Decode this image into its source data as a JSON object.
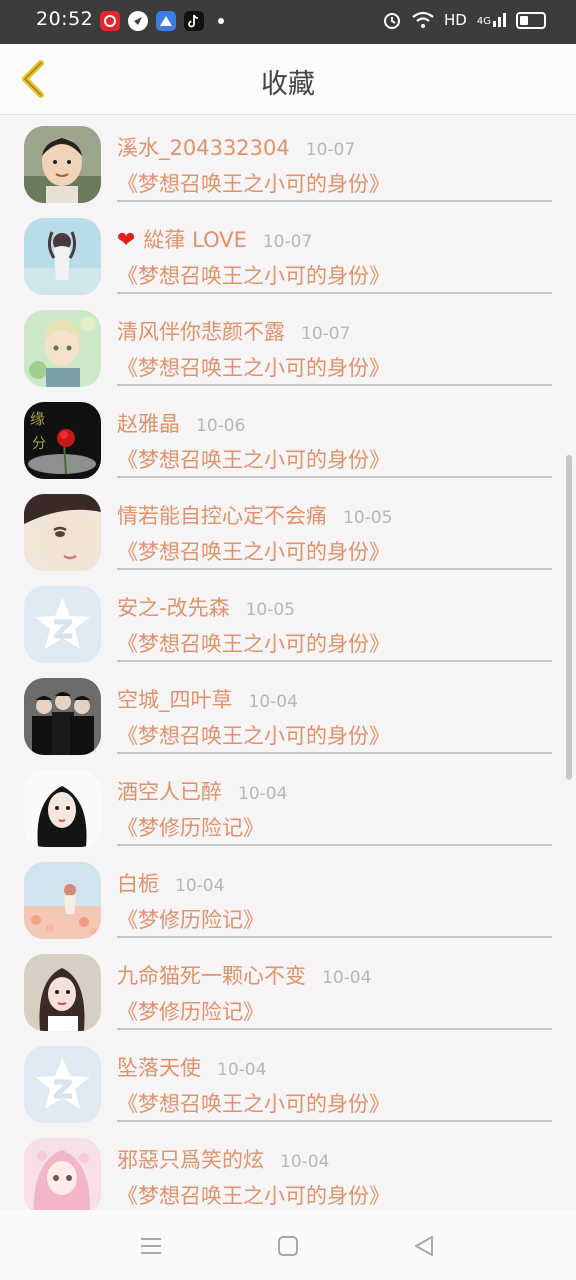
{
  "status": {
    "time": "20:52",
    "network": "HD",
    "signal": "4G",
    "apps": [
      "weibo-like-app-icon",
      "navigation-app-icon",
      "cloud-app-icon",
      "tiktok-icon"
    ]
  },
  "header": {
    "title": "收藏"
  },
  "entries": [
    {
      "name": "溪水_204332304",
      "date": "10-07",
      "work": "《梦想召唤王之小可的身份》",
      "avatar": "photo-child-avatar",
      "heart": ""
    },
    {
      "name": "緃葎 LOVE",
      "date": "10-07",
      "work": "《梦想召唤王之小可的身份》",
      "avatar": "girl-silhouette-avatar",
      "heart": "❤"
    },
    {
      "name": "清风伴你悲颜不露",
      "date": "10-07",
      "work": "《梦想召唤王之小可的身份》",
      "avatar": "anime-boy-avatar",
      "heart": ""
    },
    {
      "name": "赵雅晶",
      "date": "10-06",
      "work": "《梦想召唤王之小可的身份》",
      "avatar": "red-rose-avatar",
      "heart": ""
    },
    {
      "name": "情若能自控心定不会痛",
      "date": "10-05",
      "work": "《梦想召唤王之小可的身份》",
      "avatar": "girl-closeup-avatar",
      "heart": ""
    },
    {
      "name": "安之-改先森",
      "date": "10-05",
      "work": "《梦想召唤王之小可的身份》",
      "avatar": "default-qq-avatar",
      "heart": ""
    },
    {
      "name": "空城_四叶草",
      "date": "10-04",
      "work": "《梦想召唤王之小可的身份》",
      "avatar": "band-group-avatar",
      "heart": ""
    },
    {
      "name": "酒空人已醉",
      "date": "10-04",
      "work": "《梦修历险记》",
      "avatar": "dark-hair-girl-avatar",
      "heart": ""
    },
    {
      "name": "白栀",
      "date": "10-04",
      "work": "《梦修历险记》",
      "avatar": "flower-field-girl-avatar",
      "heart": ""
    },
    {
      "name": "九命猫死一颗心不变",
      "date": "10-04",
      "work": "《梦修历险记》",
      "avatar": "portrait-girl-avatar",
      "heart": ""
    },
    {
      "name": "坠落天使",
      "date": "10-04",
      "work": "《梦想召唤王之小可的身份》",
      "avatar": "default-qq-avatar",
      "heart": ""
    },
    {
      "name": "邪惡只爲笑的炫",
      "date": "10-04",
      "work": "《梦想召唤王之小可的身份》",
      "avatar": "pink-anime-girl-avatar",
      "heart": ""
    }
  ],
  "colors": {
    "accent": "#e0926a",
    "date": "#b7b7b7",
    "back_arrow": "#e8c12a"
  }
}
